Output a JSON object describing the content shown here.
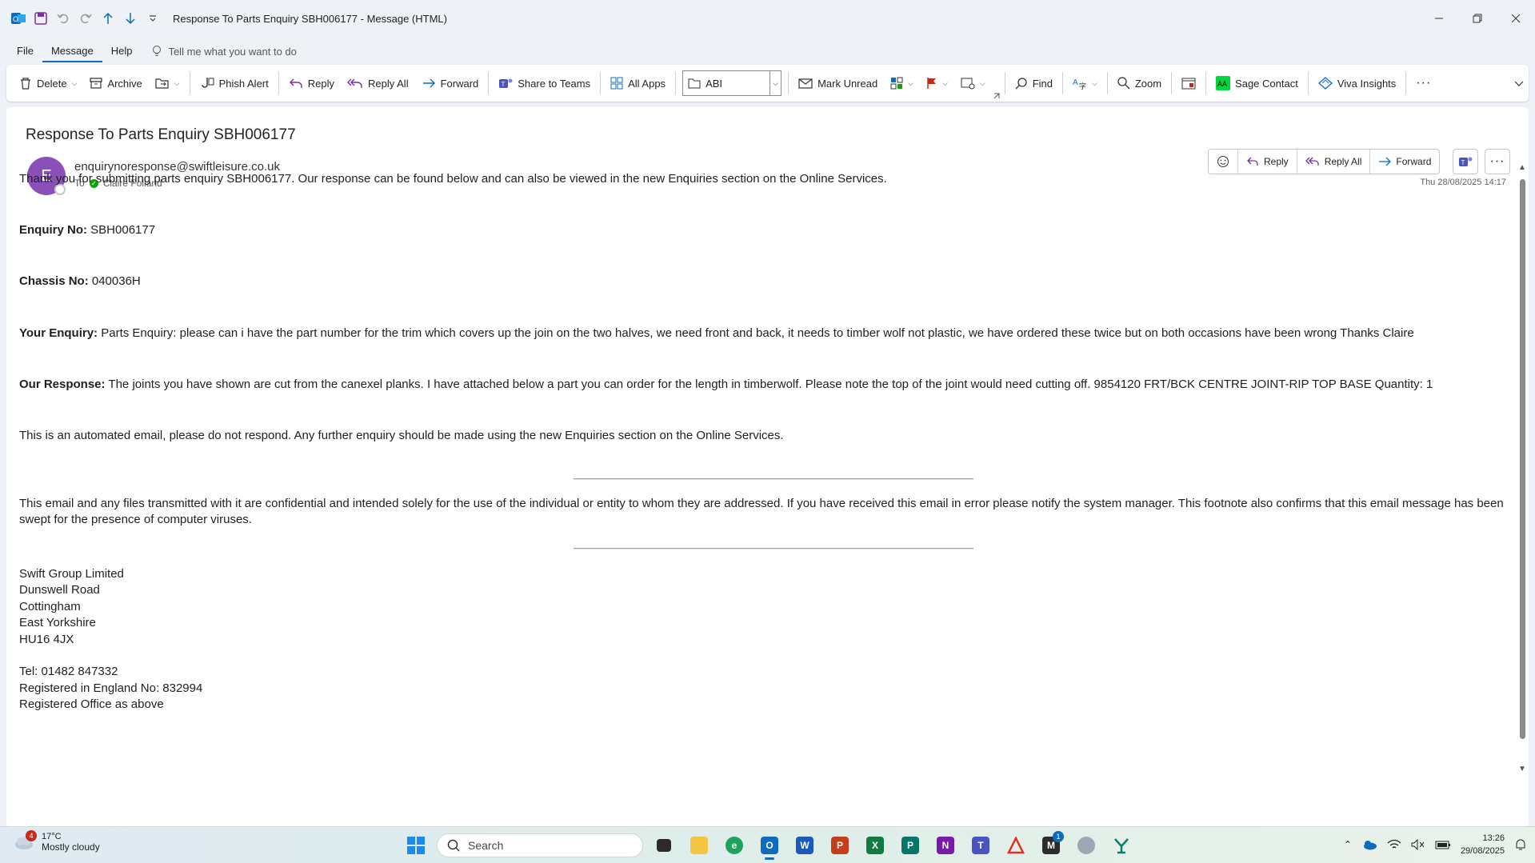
{
  "window": {
    "title": "Response To Parts Enquiry SBH006177  -  Message (HTML)"
  },
  "menu": {
    "file": "File",
    "message": "Message",
    "help": "Help",
    "tellme": "Tell me what you want to do"
  },
  "ribbon": {
    "delete": "Delete",
    "archive": "Archive",
    "phish": "Phish Alert",
    "reply": "Reply",
    "reply_all": "Reply All",
    "forward": "Forward",
    "share_teams": "Share to Teams",
    "all_apps": "All Apps",
    "abi": "ABI",
    "mark_unread": "Mark Unread",
    "find": "Find",
    "zoom": "Zoom",
    "sage": "Sage Contact",
    "viva": "Viva Insights"
  },
  "message": {
    "subject": "Response To Parts Enquiry SBH006177",
    "avatar_letter": "E",
    "sender": "enquirynoresponse@swiftleisure.co.uk",
    "to_label": "To",
    "recipient": "Claire Folland",
    "datetime": "Thu 28/08/2025 14:17",
    "actions": {
      "reply": "Reply",
      "reply_all": "Reply All",
      "forward": "Forward"
    }
  },
  "body": {
    "intro": "Thank you for submitting parts enquiry SBH006177. Our response can be found below and can also be viewed in the new Enquiries section on the Online Services.",
    "enquiry_label": "Enquiry No:",
    "enquiry_value": " SBH006177",
    "chassis_label": "Chassis No:",
    "chassis_value": " 040036H",
    "your_label": "Your Enquiry:",
    "your_value": " Parts Enquiry: please can i have the part number for the trim which covers up the join on the two halves, we need front and back, it needs to timber wolf not plastic, we have ordered these twice but on both occasions have been wrong Thanks Claire",
    "our_label": "Our Response:",
    "our_value": " The joints you have shown are cut from the canexel planks. I have attached below a part you can order for the length in timberwolf. Please note the top of the joint would need cutting off. 9854120 FRT/BCK CENTRE JOINT-RIP TOP BASE Quantity: 1",
    "automated": "This is an automated email, please do not respond. Any further enquiry should be made using the new Enquiries section on the Online Services.",
    "disclaimer": "This email and any files transmitted with it are confidential and intended solely for the use of the individual or entity to whom they are addressed. If you have received this email in error please notify the system manager. This footnote also confirms that this email message has been swept for the presence of computer viruses.",
    "address": [
      "Swift Group Limited",
      "Dunswell Road",
      "Cottingham",
      "East Yorkshire",
      "HU16 4JX"
    ],
    "contact": [
      "Tel: 01482 847332",
      "Registered in England No: 832994",
      "Registered Office as above"
    ]
  },
  "taskbar": {
    "weather_temp": "17°C",
    "weather_desc": "Mostly cloudy",
    "weather_badge": "4",
    "search": "Search",
    "teams_badge": "1",
    "time": "13:26",
    "date": "29/08/2025"
  }
}
